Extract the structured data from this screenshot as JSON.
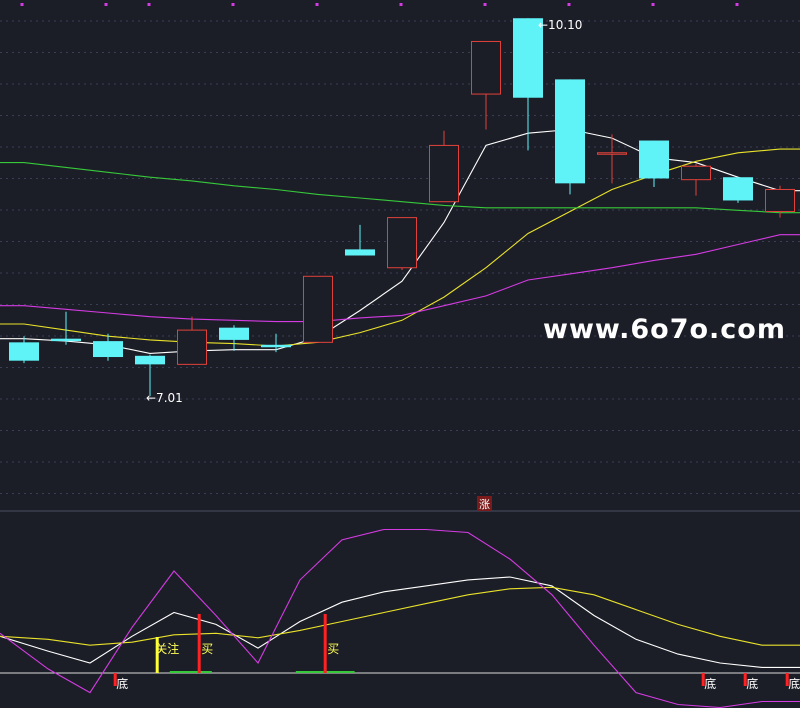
{
  "colors": {
    "background": "#1c1e27",
    "grid": "#3a3f55",
    "up": "#e0413a",
    "down": "#5ff3f7",
    "ma_white": "#ffffff",
    "ma_yellow": "#e9e22b",
    "ma_magenta": "#d43be3",
    "ma_green": "#36c93a",
    "watermark": "#ffffff",
    "signal_buy": "#ff2222",
    "signal_watch": "#ffff33",
    "tick_marker": "#d43be3"
  },
  "watermark": "www.6o7o.com",
  "chart_data": [
    {
      "type": "candlestick",
      "title": "",
      "high_label": "10.10",
      "low_label": "7.01",
      "badge": "涨",
      "ylim": [
        6.3,
        10.2
      ],
      "candles": [
        {
          "open": 7.45,
          "close": 7.3,
          "high": 7.5,
          "low": 7.28
        },
        {
          "open": 7.48,
          "close": 7.46,
          "high": 7.7,
          "low": 7.43
        },
        {
          "open": 7.46,
          "close": 7.33,
          "high": 7.52,
          "low": 7.3
        },
        {
          "open": 7.34,
          "close": 7.27,
          "high": 7.35,
          "low": 7.01
        },
        {
          "open": 7.27,
          "close": 7.55,
          "high": 7.66,
          "low": 7.27
        },
        {
          "open": 7.57,
          "close": 7.47,
          "high": 7.59,
          "low": 7.38
        },
        {
          "open": 7.43,
          "close": 7.41,
          "high": 7.52,
          "low": 7.37
        },
        {
          "open": 7.45,
          "close": 7.99,
          "high": 7.99,
          "low": 7.45
        },
        {
          "open": 8.21,
          "close": 8.16,
          "high": 8.41,
          "low": 8.16
        },
        {
          "open": 8.06,
          "close": 8.47,
          "high": 8.47,
          "low": 8.04
        },
        {
          "open": 8.6,
          "close": 9.06,
          "high": 9.18,
          "low": 8.6
        },
        {
          "open": 9.48,
          "close": 9.91,
          "high": 9.91,
          "low": 9.19
        },
        {
          "open": 10.1,
          "close": 9.45,
          "high": 10.1,
          "low": 9.02
        },
        {
          "open": 9.6,
          "close": 8.75,
          "high": 9.6,
          "low": 8.66
        },
        {
          "open": 9.0,
          "close": 9.0,
          "high": 9.15,
          "low": 8.75
        },
        {
          "open": 9.1,
          "close": 8.79,
          "high": 9.1,
          "low": 8.72
        },
        {
          "open": 8.78,
          "close": 8.89,
          "high": 8.91,
          "low": 8.65
        },
        {
          "open": 8.8,
          "close": 8.61,
          "high": 8.8,
          "low": 8.59
        },
        {
          "open": 8.52,
          "close": 8.7,
          "high": 8.73,
          "low": 8.47
        }
      ],
      "series": [
        {
          "color": "#ffffff",
          "values": [
            7.48,
            7.46,
            7.43,
            7.36,
            7.38,
            7.39,
            7.39,
            7.49,
            7.71,
            7.95,
            8.43,
            9.06,
            9.16,
            9.19,
            9.12,
            8.96,
            8.92,
            8.8,
            8.69
          ]
        },
        {
          "color": "#e9e22b",
          "values": [
            7.6,
            7.55,
            7.5,
            7.47,
            7.45,
            7.44,
            7.42,
            7.45,
            7.53,
            7.63,
            7.82,
            8.06,
            8.34,
            8.52,
            8.7,
            8.82,
            8.93,
            9.0,
            9.03
          ]
        },
        {
          "color": "#d43be3",
          "values": [
            7.75,
            7.72,
            7.69,
            7.66,
            7.64,
            7.63,
            7.62,
            7.62,
            7.65,
            7.67,
            7.75,
            7.83,
            7.96,
            8.01,
            8.06,
            8.12,
            8.17,
            8.25,
            8.33
          ]
        },
        {
          "color": "#36c93a",
          "values": [
            8.92,
            8.88,
            8.84,
            8.8,
            8.77,
            8.73,
            8.7,
            8.66,
            8.63,
            8.6,
            8.57,
            8.55,
            8.55,
            8.55,
            8.55,
            8.55,
            8.55,
            8.53,
            8.51
          ]
        }
      ]
    },
    {
      "type": "line",
      "title": "",
      "ylim": [
        -5,
        115
      ],
      "series": [
        {
          "color": "#ffffff",
          "values": [
            42,
            32,
            24,
            42,
            58,
            50,
            34,
            52,
            65,
            72,
            76,
            80,
            82,
            76,
            56,
            40,
            30,
            24,
            21
          ]
        },
        {
          "color": "#e9e22b",
          "values": [
            42,
            40,
            36,
            38,
            43,
            44,
            41,
            46,
            52,
            58,
            64,
            70,
            74,
            75,
            70,
            60,
            50,
            42,
            36
          ]
        },
        {
          "color": "#d43be3",
          "values": [
            44,
            20,
            4,
            48,
            86,
            56,
            24,
            80,
            107,
            114,
            114,
            112,
            94,
            70,
            36,
            4,
            -4,
            -6,
            -2
          ]
        }
      ],
      "signals": [
        {
          "index": 2.6,
          "label": "底",
          "kind": "bottom"
        },
        {
          "index": 3.6,
          "label": "关注",
          "kind": "watch"
        },
        {
          "index": 4.6,
          "label": "买",
          "kind": "buy"
        },
        {
          "index": 7.6,
          "label": "买",
          "kind": "buy"
        },
        {
          "index": 16.6,
          "label": "底",
          "kind": "bottom"
        },
        {
          "index": 17.6,
          "label": "底",
          "kind": "bottom"
        },
        {
          "index": 18.6,
          "label": "底",
          "kind": "bottom"
        }
      ],
      "volume_marks": [
        {
          "from": 3.9,
          "to": 4.9
        },
        {
          "from": 6.9,
          "to": 8.3
        }
      ]
    }
  ]
}
